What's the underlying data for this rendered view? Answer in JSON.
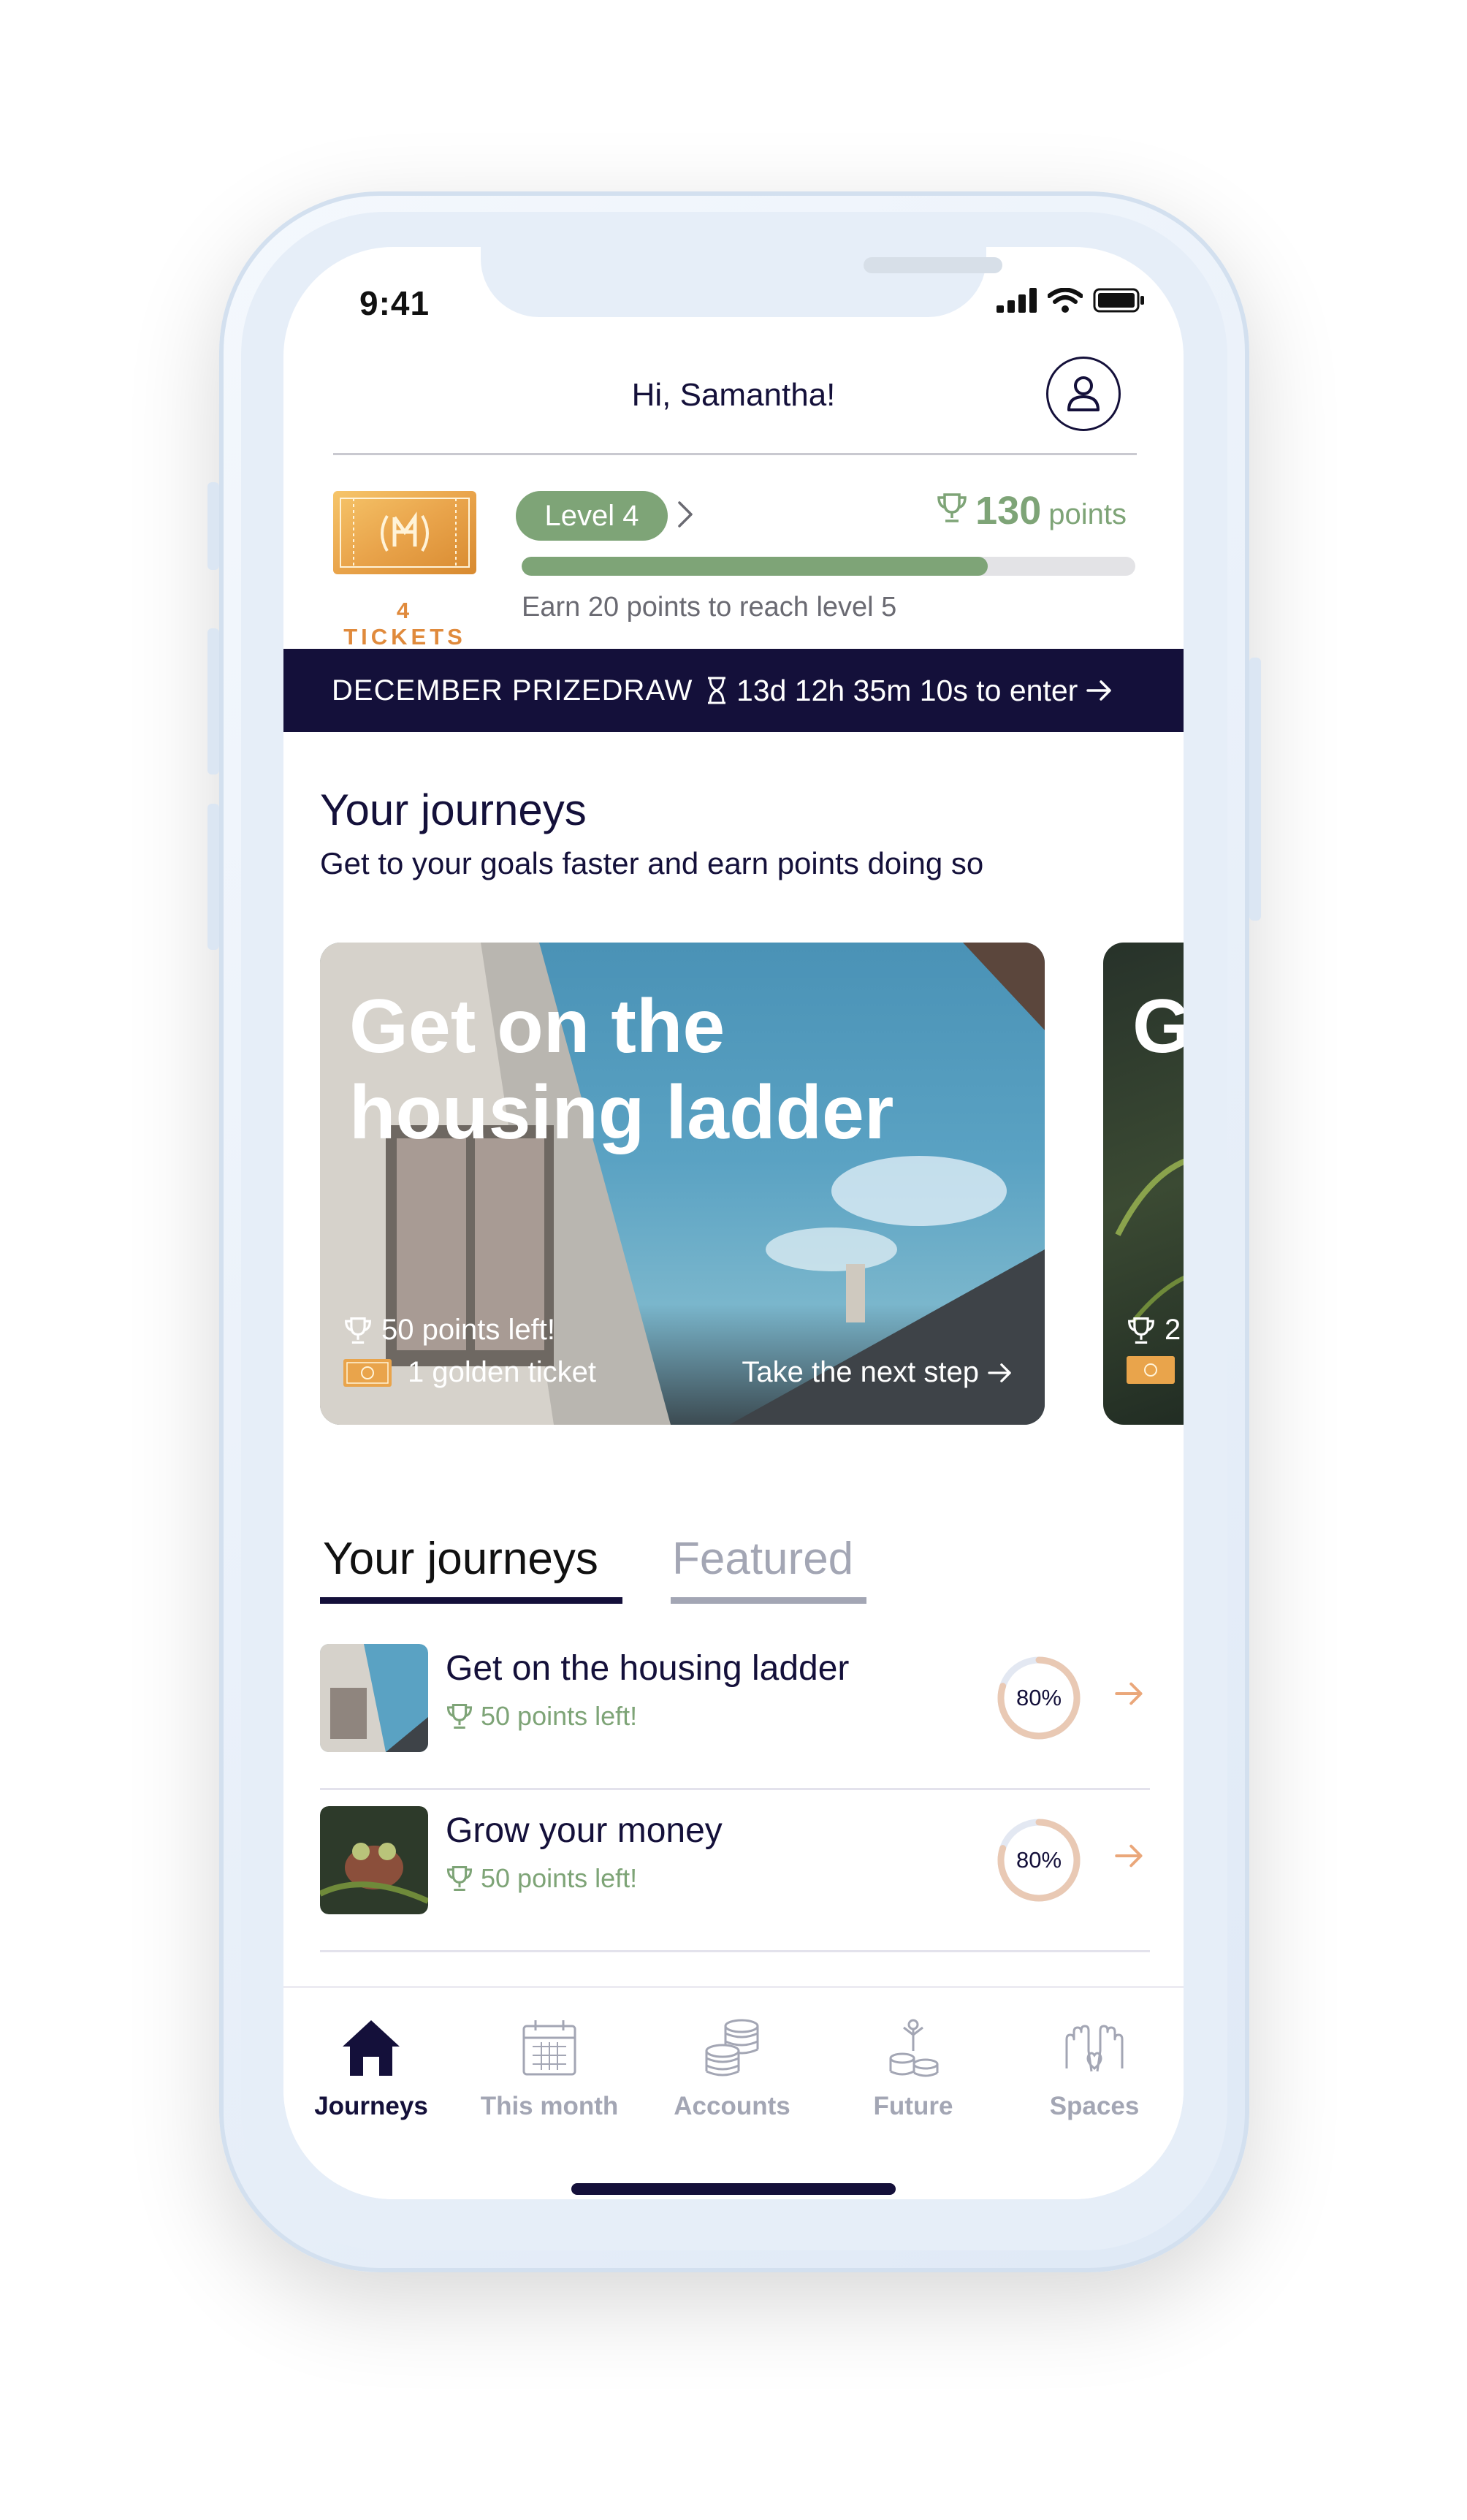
{
  "status_bar": {
    "time": "9:41"
  },
  "header": {
    "greeting": "Hi, Samantha!"
  },
  "rewards": {
    "tickets_label": "4 TICKETS",
    "level_label": "Level 4",
    "points_value": "130",
    "points_unit": "points",
    "progress_fraction": 0.76,
    "hint": "Earn 20 points to reach level 5"
  },
  "prize_draw": {
    "title": "DECEMBER PRIZEDRAW",
    "countdown": "13d 12h 35m 10s to enter"
  },
  "journeys_section": {
    "title": "Your journeys",
    "subtitle": "Get to your goals faster and earn points doing so"
  },
  "cards": [
    {
      "title": "Get on the housing ladder",
      "points": "50 points left!",
      "tickets": "1 golden ticket",
      "cta": "Take the next step"
    },
    {
      "title": "G",
      "points": "2"
    }
  ],
  "tabs": [
    {
      "label": "Your journeys",
      "active": true
    },
    {
      "label": "Featured",
      "active": false
    }
  ],
  "journey_list": [
    {
      "title": "Get on the housing ladder",
      "points": "50 points left!",
      "progress_label": "80%",
      "progress": 0.8
    },
    {
      "title": "Grow your money",
      "points": "50 points left!",
      "progress_label": "80%",
      "progress": 0.8
    }
  ],
  "bottom_nav": [
    {
      "label": "Journeys",
      "icon": "home-icon",
      "active": true
    },
    {
      "label": "This month",
      "icon": "calendar-icon",
      "active": false
    },
    {
      "label": "Accounts",
      "icon": "coins-icon",
      "active": false
    },
    {
      "label": "Future",
      "icon": "growth-icon",
      "active": false
    },
    {
      "label": "Spaces",
      "icon": "hands-icon",
      "active": false
    }
  ],
  "colors": {
    "navy": "#14103a",
    "green": "#7ea477",
    "orange": "#e08a3c",
    "grey": "#a3a6b4"
  }
}
